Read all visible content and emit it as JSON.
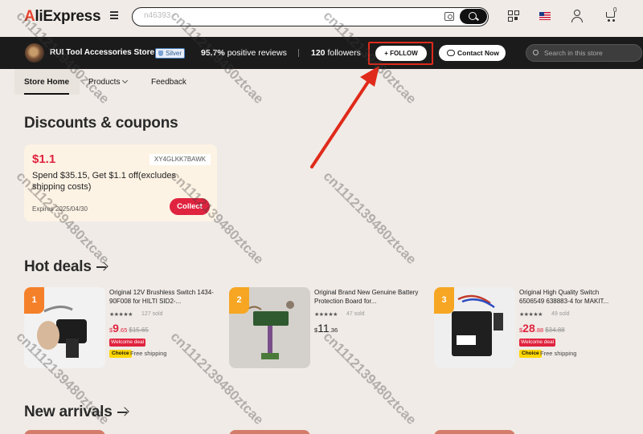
{
  "header": {
    "logo": "AliExpress",
    "search_value": "n46393",
    "cart_count": "0"
  },
  "store": {
    "name": "RUI Tool Accessories Store",
    "badge": "Silver",
    "positive": "95.7%",
    "positive_label": "positive reviews",
    "followers": "120",
    "followers_label": "followers",
    "follow_label": "+ FOLLOW",
    "contact_label": "Contact Now",
    "search_placeholder": "Search in this store"
  },
  "nav": {
    "tabs": [
      "Store Home",
      "Products",
      "Feedback"
    ]
  },
  "sections": {
    "discounts": "Discounts & coupons",
    "hot_deals": "Hot deals",
    "new_arrivals": "New arrivals"
  },
  "coupon": {
    "amount": "$1.1",
    "code": "XY4GLKK7BAWK",
    "description": "Spend $35.15, Get $1.1 off(excludes shipping costs)",
    "expires": "Expires 2025/04/30",
    "button": "Collect"
  },
  "products": [
    {
      "rank": "1",
      "title": "Original 12V Brushless Switch 1434-90F008 for HILTI SID2-...",
      "stars": "★★★★★",
      "sold": "127 sold",
      "currency": "$",
      "price_int": "9",
      "price_dec": ".65",
      "old_price": "$15.65",
      "welcome": "Welcome deal",
      "choice": "Choice",
      "shipping": "Free shipping"
    },
    {
      "rank": "2",
      "title": "Original Brand New Genuine Battery Protection Board for...",
      "stars": "★★★★★",
      "sold": "47 sold",
      "currency": "$",
      "price_int": "11",
      "price_dec": ".36"
    },
    {
      "rank": "3",
      "title": "Original High Quality Switch 6506549 638883-4 for MAKIT...",
      "stars": "★★★★★",
      "sold": "49 sold",
      "currency": "$",
      "price_int": "28",
      "price_dec": ".88",
      "old_price": "$34.88",
      "welcome": "Welcome deal",
      "choice": "Choice",
      "shipping": "Free shipping"
    }
  ],
  "watermark": "cn1112139480ztcae",
  "colors": {
    "accent_red": "#e0233f",
    "store_bar": "#1b1b1b",
    "annotation_red": "#e02a1b"
  }
}
